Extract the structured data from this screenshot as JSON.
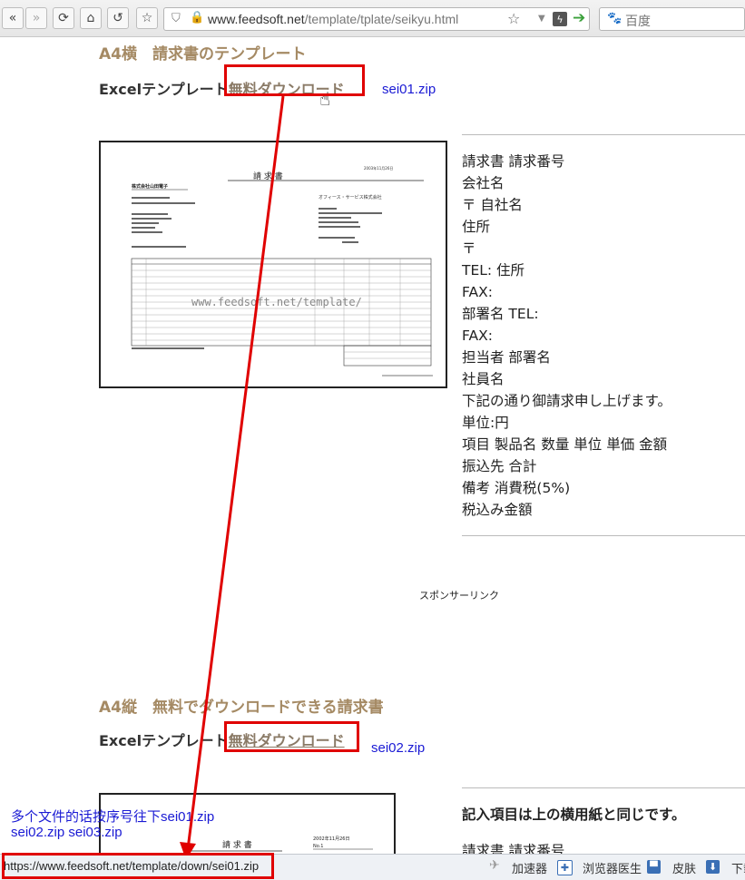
{
  "browser": {
    "url_host": "www.feedsoft.net",
    "url_path": "/template/tplate/seikyu.html",
    "search_placeholder": "百度",
    "icons": {
      "back": "double-chevron-left-icon",
      "forward": "double-chevron-right-icon",
      "reload": "reload-icon",
      "home": "home-icon",
      "undo": "undo-icon",
      "star": "star-icon",
      "lock": "lock-icon",
      "go": "arrow-right-icon",
      "baidu": "paw-icon"
    }
  },
  "section1": {
    "title": "A4横　請求書のテンプレート",
    "excel_prefix": "Excelテンプレート",
    "download_link": "無料ダウンロード",
    "zip": "sei01.zip",
    "items": [
      "請求書  請求番号",
      "会社名",
      "〒  自社名",
      "住所",
      "〒",
      "TEL:  住所",
      "FAX:",
      "部署名  TEL:",
      "FAX:",
      "担当者  部署名",
      "社員名",
      "下記の通り御請求申し上げます。",
      "単位:円",
      "項目  製品名  数量  単位  単価  金額",
      "振込先  合計",
      "備考  消費税(5%)",
      "税込み金額"
    ],
    "thumb": {
      "heading": "請 求 書",
      "watermark": "www.feedsoft.net/template/",
      "company": "株式会社山田電子",
      "vendor": "オフィース・サービス株式会社"
    }
  },
  "sponsor": "スポンサーリンク",
  "section2": {
    "title": "A4縦　無料でダウンロードできる請求書",
    "excel_prefix": "Excelテンプレート",
    "download_link": "無料ダウンロード",
    "zip": "sei02.zip",
    "note": "記入項目は上の横用紙と同じです。",
    "first_item": "請求書  請求番号",
    "thumb": {
      "heading": "請 求 書",
      "date": "2002年11月26日",
      "no": "No.1"
    }
  },
  "annotation": {
    "line1": "多个文件的话按序号往下sei01.zip",
    "line2": "sei02.zip sei03.zip"
  },
  "statusbar": {
    "url": "https://www.feedsoft.net/template/down/sei01.zip",
    "accelerator": "加速器",
    "doctor": "浏览器医生",
    "skin": "皮肤",
    "download": "下载"
  },
  "colors": {
    "heading": "#a58a64",
    "link": "#1a1ad4",
    "annotation_red": "#e00000"
  }
}
